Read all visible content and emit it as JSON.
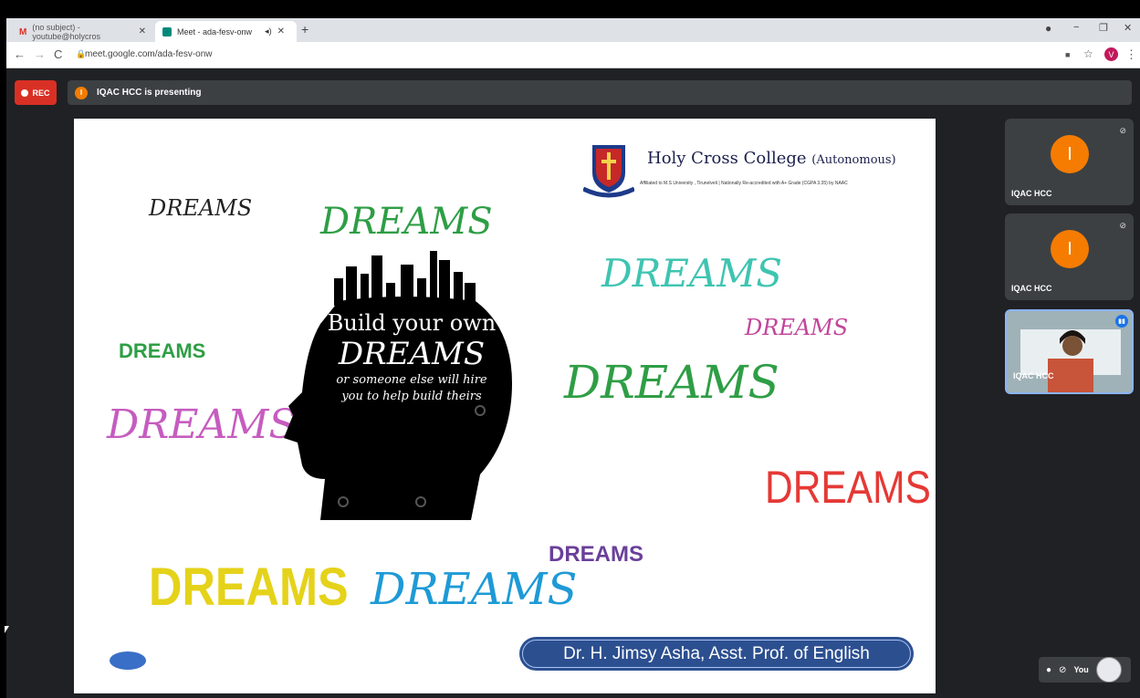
{
  "browser": {
    "tabs": [
      {
        "label": "(no subject) - youtube@holycros",
        "close": "✕"
      },
      {
        "label": "Meet - ada-fesv-onw",
        "close": "✕"
      }
    ],
    "new_tab": "+",
    "url": "meet.google.com/ada-fesv-onw",
    "profile_initial": "V"
  },
  "meet": {
    "rec_label": "REC",
    "presenting_text": "IQAC HCC is presenting",
    "presenter_initial": "I",
    "participants": [
      {
        "name": "IQAC HCC",
        "initial": "I"
      },
      {
        "name": "IQAC HCC",
        "initial": "I"
      },
      {
        "name": "IQAC HCC"
      }
    ],
    "self_label": "You"
  },
  "slide": {
    "college_name": "Holy Cross College",
    "college_suffix": "(Autonomous)",
    "affiliation": "Affiliated to M.S University , Tirunelveli | Nationally Re-accredited with A+ Grade (CGPA 3.35) by NAAC",
    "head_line1": "Build your own",
    "head_line2": "DREAMS",
    "head_line3": "or someone else will hire",
    "head_line4": "you to help build theirs",
    "word": "DREAMS",
    "speaker": "Dr. H. Jimsy  Asha,  Asst. Prof. of English"
  },
  "colors": {
    "rec": "#d93025",
    "meet_bg": "#202124",
    "avatar": "#f57c00",
    "speaker_bar": "#2c4f90"
  }
}
